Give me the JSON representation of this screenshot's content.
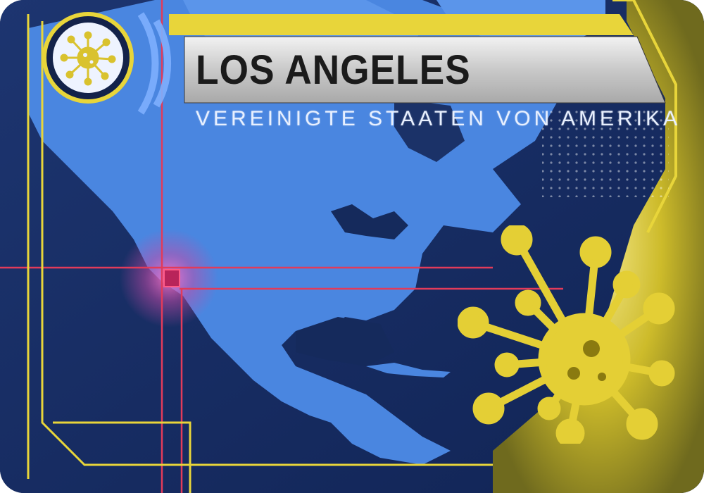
{
  "card": {
    "city": "LOS ANGELES",
    "country": "VEREINIGTE STAATEN VON AMERIKA",
    "colors": {
      "frame_yellow": "#e8d53a",
      "map_blue": "#3f78d6",
      "ocean_navy": "#152a5c",
      "marker_red": "#e23b5a"
    },
    "icons": {
      "badge": "virus-icon",
      "large": "virus-icon"
    }
  }
}
